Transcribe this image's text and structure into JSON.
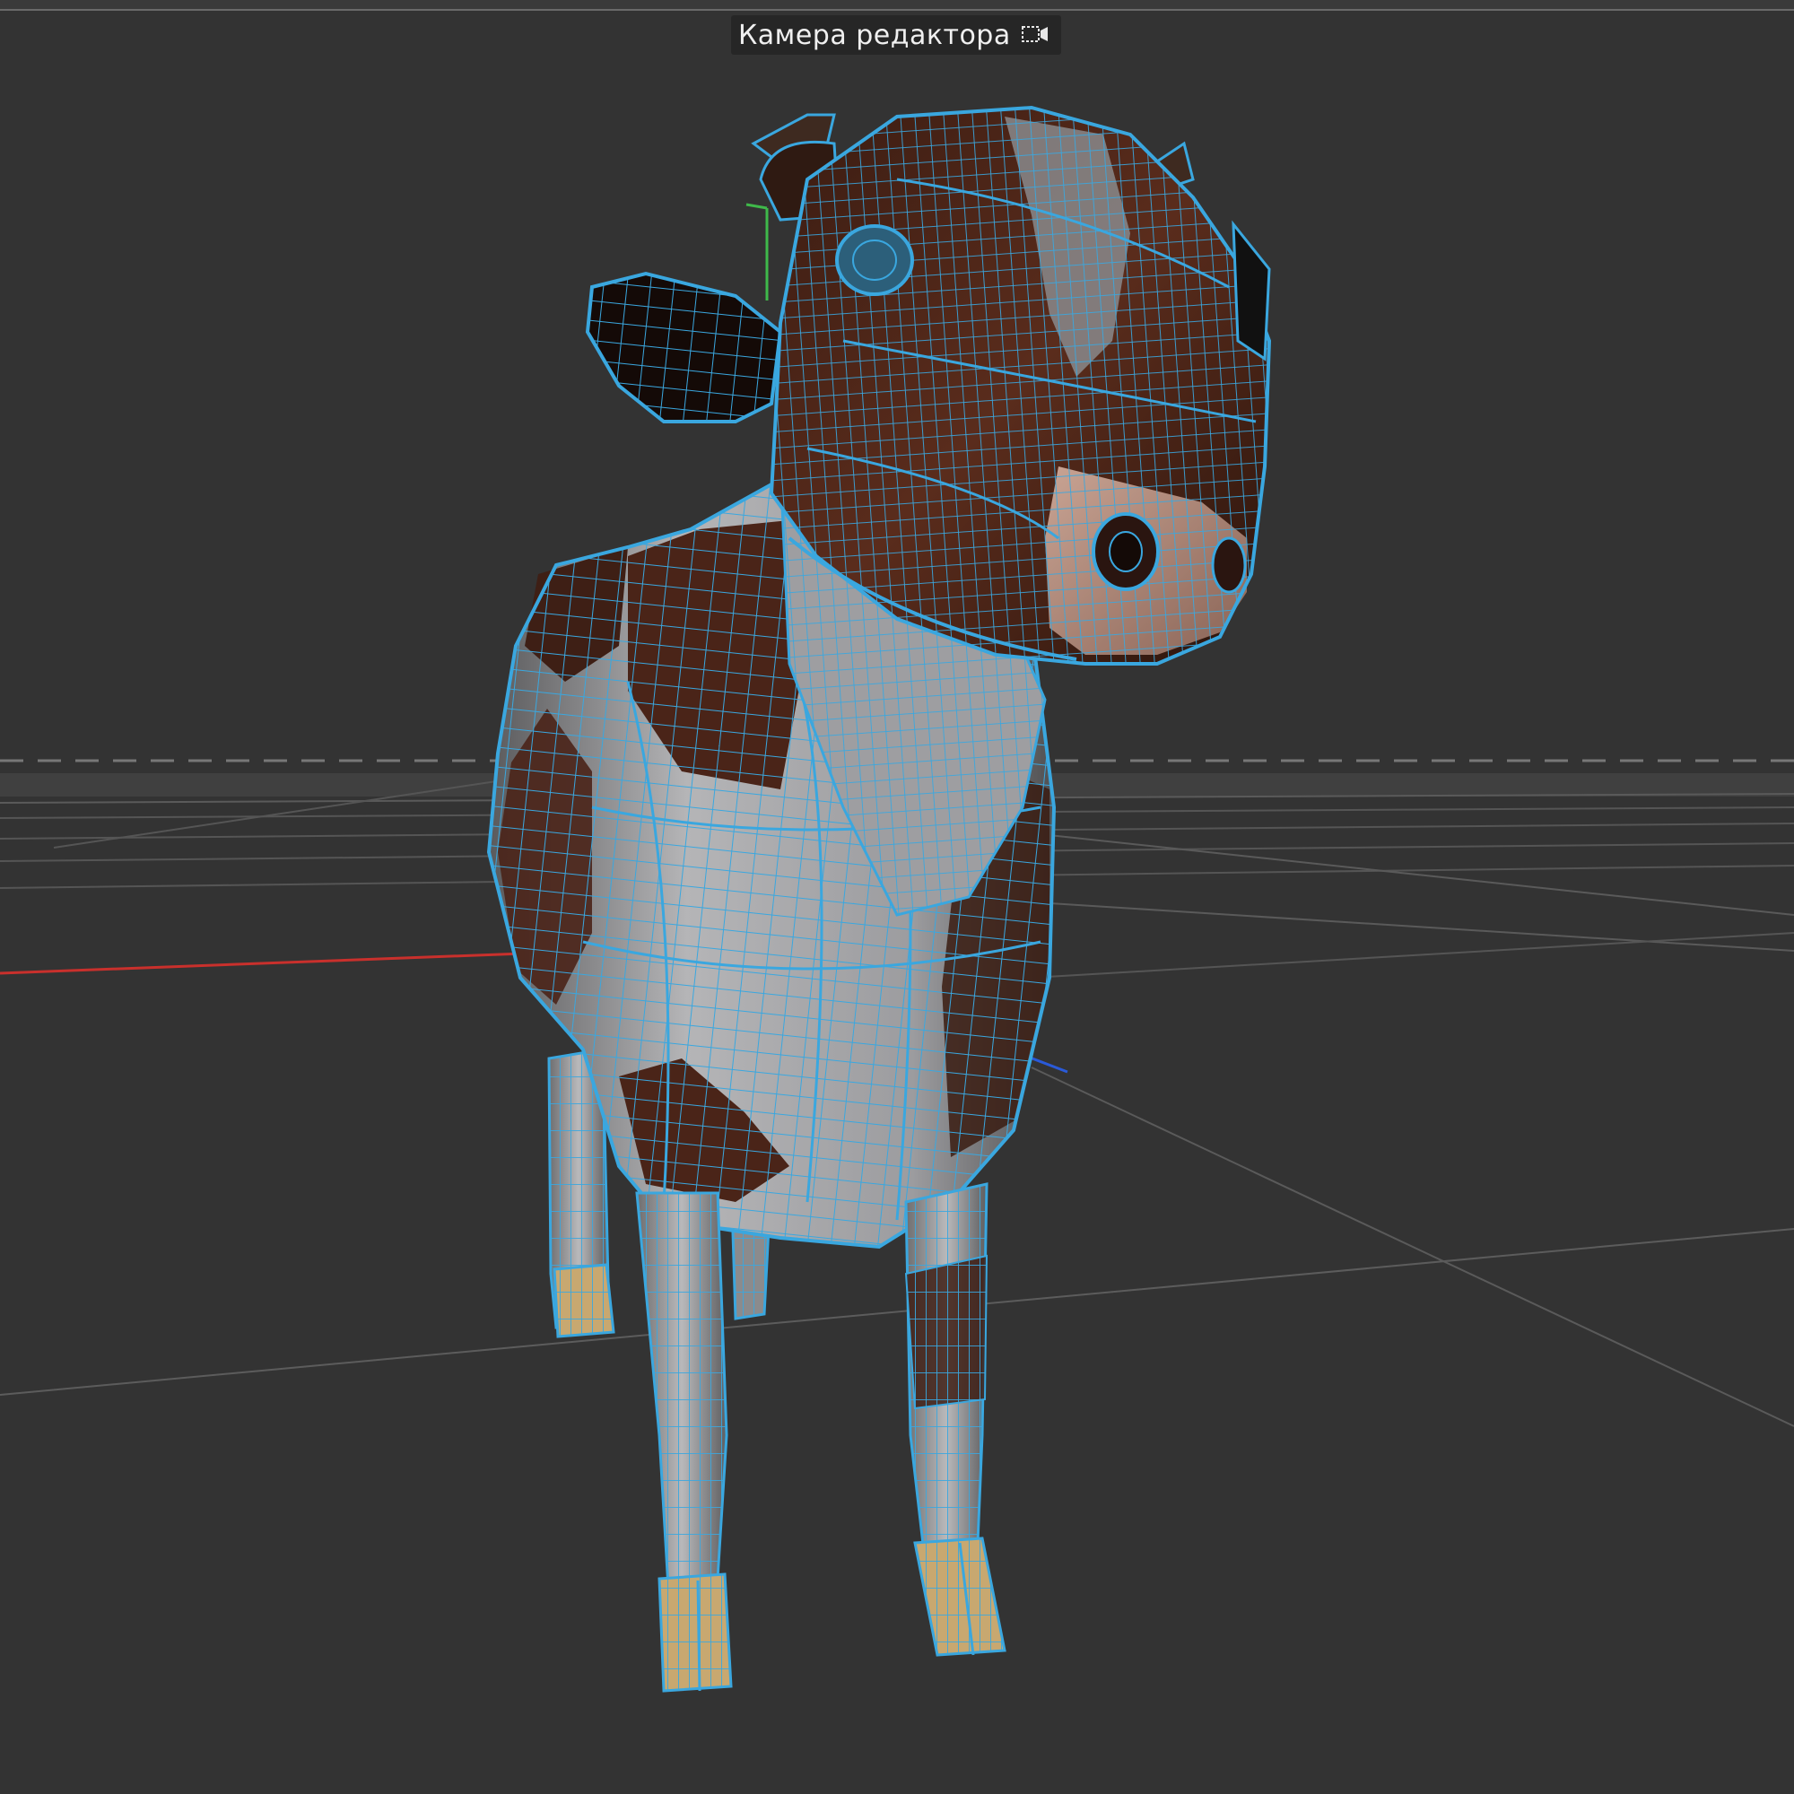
{
  "viewport": {
    "camera_label": "Камера редактора",
    "camera_icon": "video-camera-icon",
    "background_color": "#333333",
    "wireframe_color": "#3aa7df",
    "axis_colors": {
      "x": "#c9302c",
      "y": "#3fb94a",
      "z": "#2a5ad8"
    },
    "model_texture_colors": {
      "dark_patch": "#4a2418",
      "light_patch": "#a9a9ab",
      "hoof": "#c8a870",
      "muzzle": "#b28c7c"
    },
    "grid_visible": true
  }
}
